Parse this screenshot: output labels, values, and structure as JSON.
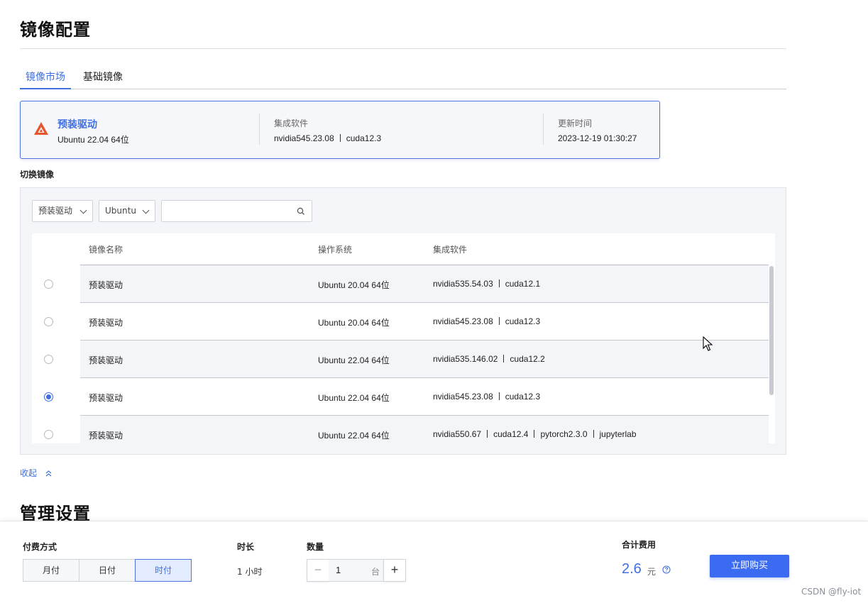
{
  "page": {
    "section1_title": "镜像配置",
    "section2_title": "管理设置"
  },
  "tabs": [
    {
      "label": "镜像市场",
      "active": true
    },
    {
      "label": "基础镜像",
      "active": false
    }
  ],
  "current_image": {
    "name": "预装驱动",
    "os": "Ubuntu 22.04 64位",
    "software_label": "集成软件",
    "software": [
      "nvidia545.23.08",
      "cuda12.3"
    ],
    "updated_label": "更新时间",
    "updated": "2023-12-19 01:30:27",
    "icon": "driver-logo-icon"
  },
  "switch": {
    "label": "切换镜像",
    "filter_type": "预装驱动",
    "filter_os": "Ubuntu",
    "search_placeholder": "",
    "columns": [
      "镜像名称",
      "操作系统",
      "集成软件"
    ],
    "rows": [
      {
        "name": "预装驱动",
        "os": "Ubuntu 20.04 64位",
        "software": [
          "nvidia535.54.03",
          "cuda12.1"
        ],
        "selected": false
      },
      {
        "name": "预装驱动",
        "os": "Ubuntu 20.04 64位",
        "software": [
          "nvidia545.23.08",
          "cuda12.3"
        ],
        "selected": false
      },
      {
        "name": "预装驱动",
        "os": "Ubuntu 22.04 64位",
        "software": [
          "nvidia535.146.02",
          "cuda12.2"
        ],
        "selected": false
      },
      {
        "name": "预装驱动",
        "os": "Ubuntu 22.04 64位",
        "software": [
          "nvidia545.23.08",
          "cuda12.3"
        ],
        "selected": true
      },
      {
        "name": "预装驱动",
        "os": "Ubuntu 22.04 64位",
        "software": [
          "nvidia550.67",
          "cuda12.4",
          "pytorch2.3.0",
          "jupyterlab"
        ],
        "selected": false
      }
    ],
    "collapse_label": "收起"
  },
  "footer": {
    "payment_label": "付费方式",
    "payment_options": [
      "月付",
      "日付",
      "时付"
    ],
    "payment_selected": "时付",
    "duration_label": "时长",
    "duration_value": "1 小时",
    "quantity_label": "数量",
    "quantity_value": "1",
    "quantity_unit": "台",
    "minus": "−",
    "plus": "+",
    "total_label": "合计费用",
    "total_value": "2.6",
    "total_unit": "元",
    "buy_label": "立即购买",
    "watermark": "CSDN @fly-iot"
  },
  "colors": {
    "accent": "#3f6fe0",
    "buy_button": "#3b6bf0",
    "logo": "#e8542c"
  }
}
